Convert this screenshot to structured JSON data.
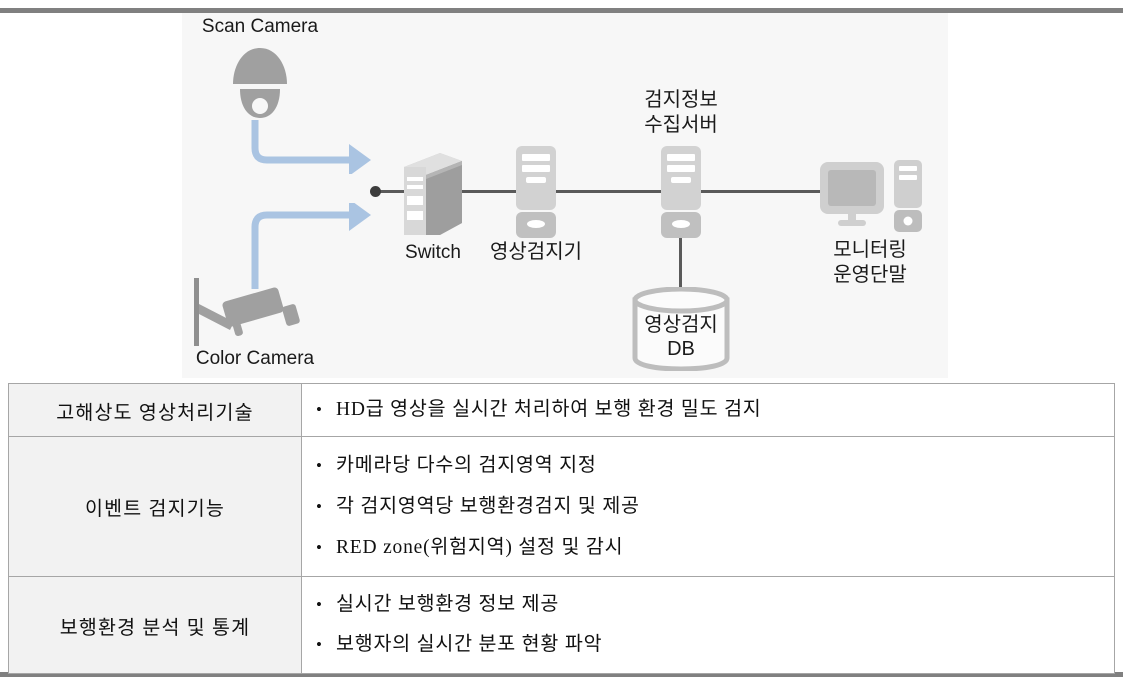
{
  "diagram": {
    "background_color": "#f7f7f7",
    "link_color": "#5a5a5a",
    "arrow_color": "#aac4e2",
    "icon_color": "#a8a8a8",
    "nodes": [
      {
        "id": "scan-camera",
        "label": "Scan Camera",
        "icon": "dome-camera-icon"
      },
      {
        "id": "color-camera",
        "label": "Color Camera",
        "icon": "bullet-camera-icon"
      },
      {
        "id": "switch",
        "label": "Switch",
        "icon": "rack-switch-icon"
      },
      {
        "id": "video-detector",
        "label": "영상검지기",
        "icon": "pc-tower-icon"
      },
      {
        "id": "collection-server",
        "label": "검지정보\n수집서버",
        "icon": "server-tower-icon"
      },
      {
        "id": "video-db",
        "label": "영상검지\nDB",
        "icon": "database-cylinder-icon"
      },
      {
        "id": "monitoring-term",
        "label": "모니터링\n운영단말",
        "icon": "desktop-computer-icon"
      }
    ]
  },
  "table": {
    "rows": [
      {
        "category": "고해상도 영상처리기술",
        "items": [
          "HD급 영상을 실시간 처리하여 보행 환경  밀도 검지"
        ]
      },
      {
        "category": "이벤트 검지기능",
        "items": [
          "카메라당 다수의 검지영역 지정",
          "각 검지영역당 보행환경검지 및 제공",
          "RED zone(위험지역) 설정 및 감시"
        ]
      },
      {
        "category": "보행환경 분석 및 통계",
        "items": [
          "실시간 보행환경 정보 제공",
          "보행자의 실시간 분포 현황 파악"
        ]
      }
    ]
  }
}
